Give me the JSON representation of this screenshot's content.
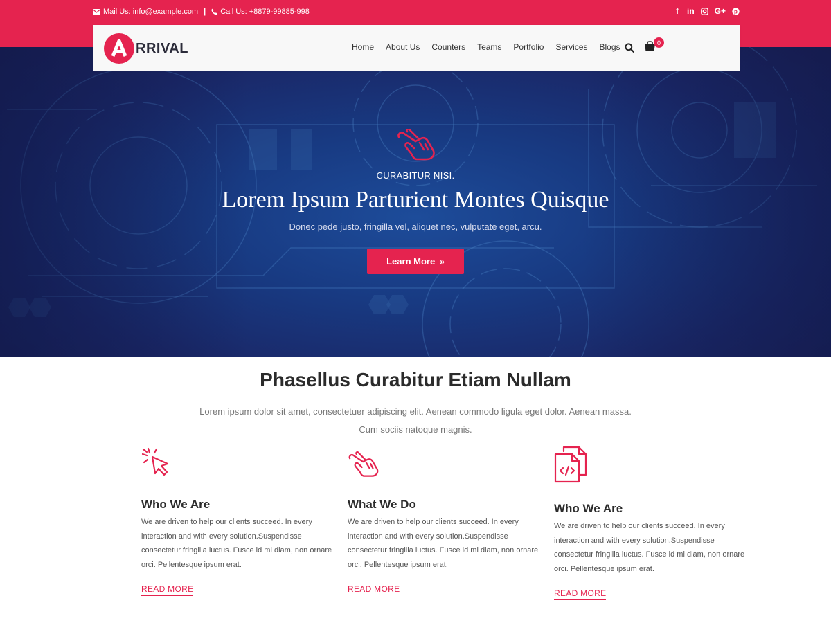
{
  "topbar": {
    "mail_text": "Mail Us: info@example.com",
    "separator": "|",
    "call_text": "Call Us: +8879-99885-998",
    "social": [
      "f",
      "in",
      "ig",
      "G+",
      "p"
    ]
  },
  "brand": {
    "logo_text": "RRIVAL",
    "accent": "#e5234f"
  },
  "nav": {
    "items": [
      "Home",
      "About Us",
      "Counters",
      "Teams",
      "Portfolio",
      "Services",
      "Blogs"
    ],
    "cart_count": "0"
  },
  "hero": {
    "eyebrow": "CURABITUR NISI.",
    "title": "Lorem Ipsum Parturient Montes Quisque",
    "subtitle": "Donec pede justo, fringilla vel, aliquet nec, vulputate eget, arcu.",
    "button_label": "Learn More"
  },
  "section": {
    "title": "Phasellus Curabitur Etiam Nullam",
    "intro_line1": "Lorem ipsum dolor sit amet, consectetuer adipiscing elit. Aenean commodo ligula eget dolor. Aenean massa.",
    "intro_line2": "Cum sociis natoque magnis."
  },
  "features": [
    {
      "icon": "cursor-click-icon",
      "title": "Who We Are",
      "text": "We are driven to help our clients succeed. In every interaction and with every solution.Suspendisse consectetur fringilla luctus. Fusce id mi diam, non ornare orci. Pellentesque ipsum erat.",
      "link": "READ MORE"
    },
    {
      "icon": "hand-pointer-icon",
      "title": "What We Do",
      "text": "We are driven to help our clients succeed. In every interaction and with every solution.Suspendisse consectetur fringilla luctus. Fusce id mi diam, non ornare orci. Pellentesque ipsum erat.",
      "link": "READ MORE"
    },
    {
      "icon": "code-files-icon",
      "title": "Who We Are",
      "text": "We are driven to help our clients succeed. In every interaction and with every solution.Suspendisse consectetur fringilla luctus. Fusce id mi diam, non ornare orci. Pellentesque ipsum erat.",
      "link": "READ MORE"
    }
  ]
}
